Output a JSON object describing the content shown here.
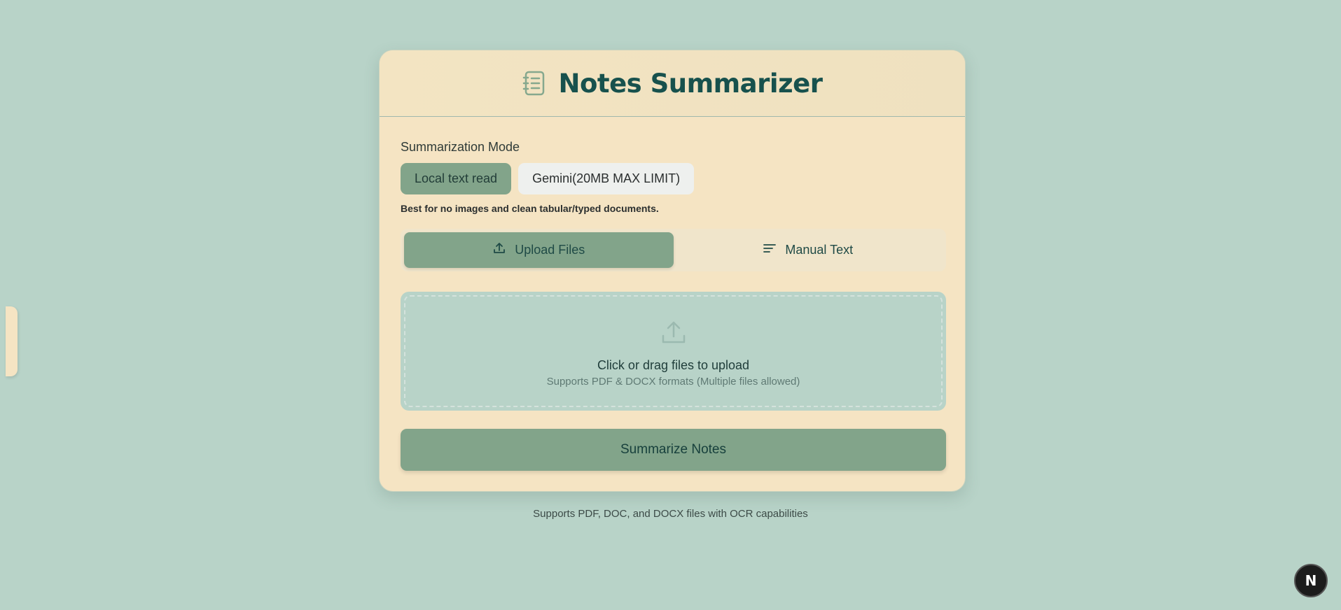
{
  "app": {
    "title": "Notes Summarizer",
    "icon": "notebook-icon"
  },
  "mode": {
    "label": "Summarization Mode",
    "options": [
      {
        "label": "Local text read",
        "active": true
      },
      {
        "label": "Gemini(20MB MAX LIMIT)",
        "active": false
      }
    ],
    "hint": "Best for no images and clean tabular/typed documents."
  },
  "tabs": [
    {
      "label": "Upload Files",
      "icon": "upload-icon",
      "active": true
    },
    {
      "label": "Manual Text",
      "icon": "text-lines-icon",
      "active": false
    }
  ],
  "dropzone": {
    "icon": "upload-icon",
    "title": "Click or drag files to upload",
    "subtitle": "Supports PDF & DOCX formats (Multiple files allowed)"
  },
  "submit_label": "Summarize Notes",
  "footer_note": "Supports PDF, DOC, and DOCX files with OCR capabilities",
  "dev_badge": "N",
  "colors": {
    "background": "#b8d3c8",
    "card": "#f5e4c3",
    "accent": "#82a48a",
    "title": "#17514d"
  }
}
